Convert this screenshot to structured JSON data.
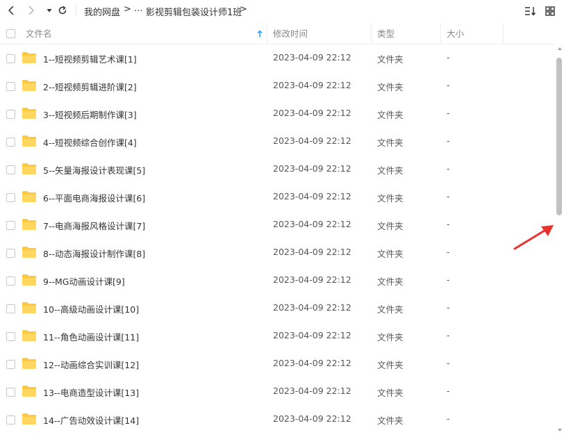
{
  "breadcrumb": {
    "root": "我的网盘",
    "ellipsis": "...",
    "current": "影视剪辑包装设计师1班",
    "separator": ">"
  },
  "columns": {
    "name": "文件名",
    "modified": "修改时间",
    "type": "类型",
    "size": "大小"
  },
  "files": [
    {
      "name": "1--短视频剪辑艺术课[1]",
      "modified": "2023-04-09 22:12",
      "type": "文件夹",
      "size": "-"
    },
    {
      "name": "2--短视频剪辑进阶课[2]",
      "modified": "2023-04-09 22:12",
      "type": "文件夹",
      "size": "-"
    },
    {
      "name": "3--短视频后期制作课[3]",
      "modified": "2023-04-09 22:12",
      "type": "文件夹",
      "size": "-"
    },
    {
      "name": "4--短视频综合创作课[4]",
      "modified": "2023-04-09 22:12",
      "type": "文件夹",
      "size": "-"
    },
    {
      "name": "5--矢量海报设计表现课[5]",
      "modified": "2023-04-09 22:12",
      "type": "文件夹",
      "size": "-"
    },
    {
      "name": "6--平面电商海报设计课[6]",
      "modified": "2023-04-09 22:12",
      "type": "文件夹",
      "size": "-"
    },
    {
      "name": "7--电商海报风格设计课[7]",
      "modified": "2023-04-09 22:12",
      "type": "文件夹",
      "size": "-"
    },
    {
      "name": "8--动态海报设计制作课[8]",
      "modified": "2023-04-09 22:12",
      "type": "文件夹",
      "size": "-"
    },
    {
      "name": "9--MG动画设计课[9]",
      "modified": "2023-04-09 22:12",
      "type": "文件夹",
      "size": "-"
    },
    {
      "name": "10--高级动画设计课[10]",
      "modified": "2023-04-09 22:12",
      "type": "文件夹",
      "size": "-"
    },
    {
      "name": "11--角色动画设计课[11]",
      "modified": "2023-04-09 22:12",
      "type": "文件夹",
      "size": "-"
    },
    {
      "name": "12--动画综合实训课[12]",
      "modified": "2023-04-09 22:12",
      "type": "文件夹",
      "size": "-"
    },
    {
      "name": "13--电商造型设计课[13]",
      "modified": "2023-04-09 22:12",
      "type": "文件夹",
      "size": "-"
    },
    {
      "name": "14--广告动效设计课[14]",
      "modified": "2023-04-09 22:12",
      "type": "文件夹",
      "size": "-"
    }
  ],
  "colors": {
    "folder": "#ffc93c",
    "sort_arrow": "#1a9cff",
    "annotation_arrow": "#e8322b"
  },
  "icons": {
    "back": "chevron-left-icon",
    "forward": "chevron-right-icon",
    "history": "caret-down-icon",
    "refresh": "refresh-icon",
    "sort": "sort-icon",
    "view": "grid-view-icon",
    "folder": "folder-icon"
  }
}
